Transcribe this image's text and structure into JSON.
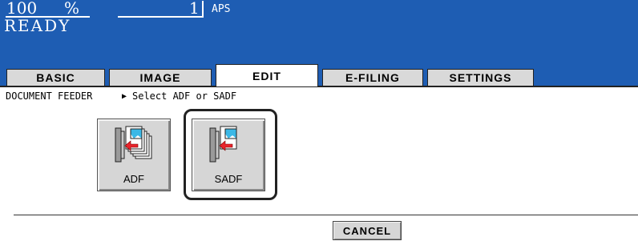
{
  "status": {
    "zoom_value": "100",
    "zoom_unit": "%",
    "copies": "1",
    "paper": "APS",
    "state": "READY"
  },
  "tabs": [
    {
      "label": "BASIC",
      "active": false
    },
    {
      "label": "IMAGE",
      "active": false
    },
    {
      "label": "EDIT",
      "active": true
    },
    {
      "label": "E-FILING",
      "active": false
    },
    {
      "label": "SETTINGS",
      "active": false
    }
  ],
  "breadcrumb": {
    "section": "DOCUMENT FEEDER",
    "arrow": "▶",
    "instruction": "Select ADF or SADF"
  },
  "options": {
    "adf": {
      "label": "ADF",
      "selected": false,
      "icon": "adf-feeder-icon"
    },
    "sadf": {
      "label": "SADF",
      "selected": true,
      "icon": "sadf-feeder-icon"
    }
  },
  "footer": {
    "cancel_label": "CANCEL"
  },
  "colors": {
    "header": "#1e5db3",
    "button": "#d6d6d6",
    "accent_red": "#e8242c",
    "accent_cyan": "#3bb8e6"
  }
}
